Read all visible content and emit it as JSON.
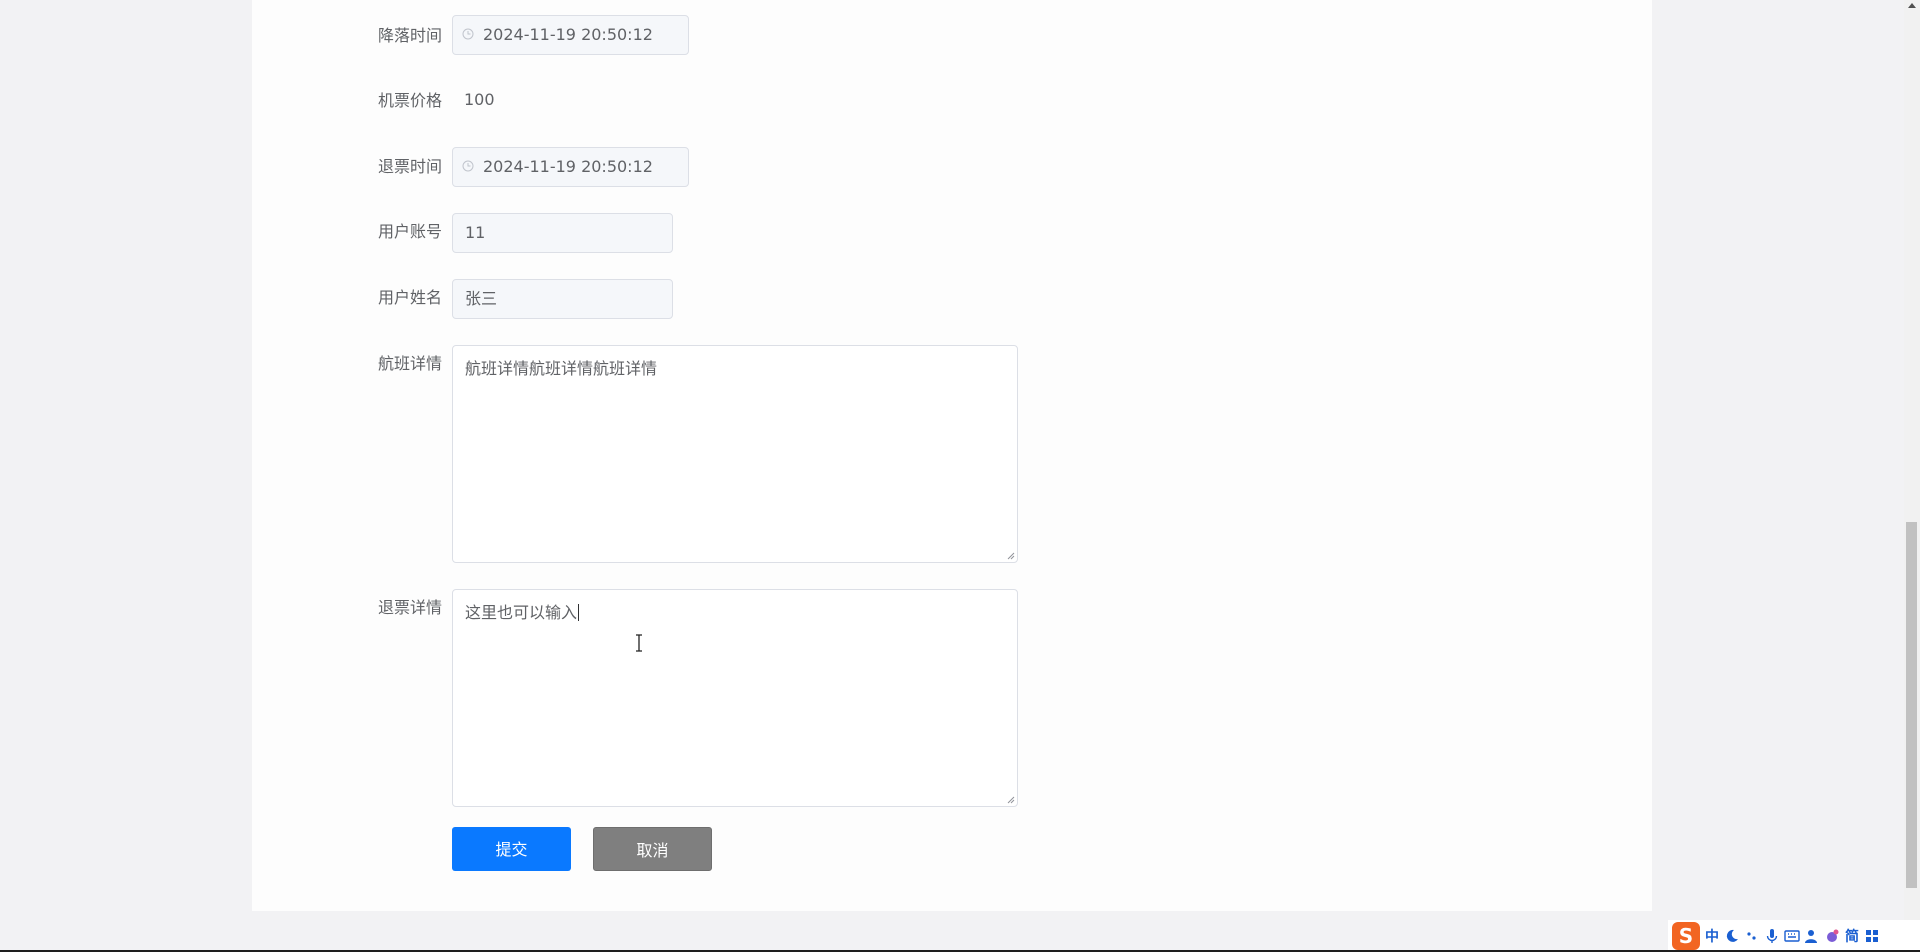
{
  "form": {
    "landing_time": {
      "label": "降落时间",
      "value": "2024-11-19 20:50:12"
    },
    "ticket_price": {
      "label": "机票价格",
      "value": "100"
    },
    "refund_time": {
      "label": "退票时间",
      "value": "2024-11-19 20:50:12"
    },
    "user_account": {
      "label": "用户账号",
      "value": "11"
    },
    "user_name": {
      "label": "用户姓名",
      "value": "张三"
    },
    "flight_details": {
      "label": "航班详情",
      "value": "航班详情航班详情航班详情"
    },
    "refund_details": {
      "label": "退票详情",
      "value": "这里也可以输入"
    }
  },
  "buttons": {
    "submit": "提交",
    "cancel": "取消"
  },
  "ime": {
    "logo": "S",
    "mode": "中",
    "charset": "简"
  },
  "icons": {
    "clock": "clock-icon",
    "resize": "resize-grip-icon",
    "ime_moon": "moon-icon",
    "ime_punct": "punctuation-icon",
    "ime_mic": "microphone-icon",
    "ime_keyboard": "keyboard-icon",
    "ime_user": "user-icon",
    "ime_skin": "skin-icon",
    "ime_menu": "grid-menu-icon"
  },
  "colors": {
    "primary": "#0a79ff",
    "cancel": "#7f7f7f",
    "ime_brand": "#f26522"
  }
}
